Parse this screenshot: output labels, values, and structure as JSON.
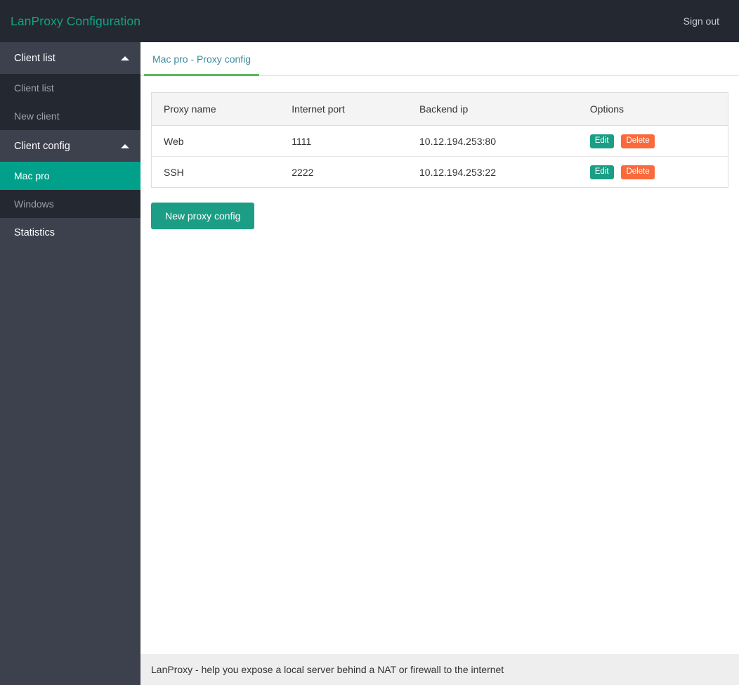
{
  "navbar": {
    "brand": "LanProxy Configuration",
    "signout": "Sign out"
  },
  "sidebar": {
    "groups": [
      {
        "label": "Client list",
        "caret": "caret-up-icon",
        "items": [
          {
            "label": "Client list",
            "active": false
          },
          {
            "label": "New client",
            "active": false
          }
        ]
      },
      {
        "label": "Client config",
        "caret": "caret-up-icon",
        "items": [
          {
            "label": "Mac pro",
            "active": true
          },
          {
            "label": "Windows",
            "active": false
          }
        ]
      }
    ],
    "plain_items": [
      {
        "label": "Statistics"
      }
    ]
  },
  "content": {
    "tab": {
      "label": "Mac pro - Proxy config",
      "active": true
    },
    "table": {
      "headers": [
        "Proxy name",
        "Internet port",
        "Backend ip",
        "Options"
      ],
      "rows": [
        {
          "proxy_name": "Web",
          "internet_port": "1111",
          "backend_ip": "10.12.194.253:80",
          "edit_label": "Edit",
          "delete_label": "Delete"
        },
        {
          "proxy_name": "SSH",
          "internet_port": "2222",
          "backend_ip": "10.12.194.253:22",
          "edit_label": "Edit",
          "delete_label": "Delete"
        }
      ]
    },
    "new_button_label": "New proxy config"
  },
  "footer": {
    "text": "LanProxy - help you expose a local server behind a NAT or firewall to the internet"
  },
  "colors": {
    "navbar_bg": "#242830",
    "brand_text": "#16a085",
    "sidebar_bg": "#3d414e",
    "submenu_bg": "#242830",
    "active_item_bg": "#00a08a",
    "tab_underline": "#5cb85c",
    "tab_text": "#3b8a9e",
    "btn_primary": "#1b9e85",
    "btn_danger": "#fa6a3c",
    "footer_bg": "#eeeeee",
    "table_header_bg": "#f4f4f4"
  }
}
